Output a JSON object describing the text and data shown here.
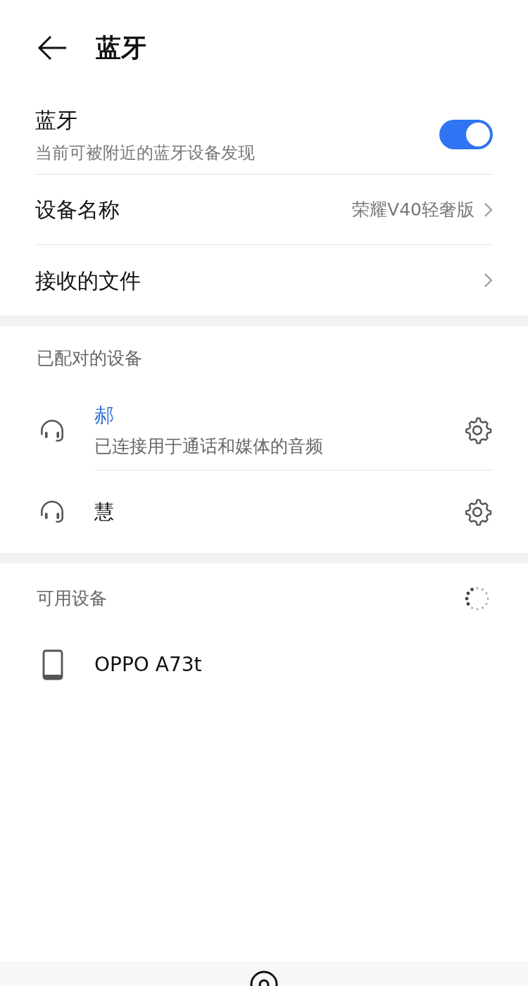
{
  "header": {
    "title": "蓝牙"
  },
  "bluetooth": {
    "label": "蓝牙",
    "subtitle": "当前可被附近的蓝牙设备发现",
    "on": true
  },
  "settings": [
    {
      "label": "设备名称",
      "value": "荣耀V40轻奢版"
    },
    {
      "label": "接收的文件"
    }
  ],
  "paired": {
    "title": "已配对的设备",
    "devices": [
      {
        "name": "郝",
        "connected": true,
        "status": "已连接用于通话和媒体的音频"
      },
      {
        "name": "慧",
        "connected": false
      }
    ]
  },
  "available": {
    "title": "可用设备",
    "scanning": true,
    "devices": [
      {
        "name": "OPPO A73t",
        "kind": "phone"
      }
    ]
  }
}
